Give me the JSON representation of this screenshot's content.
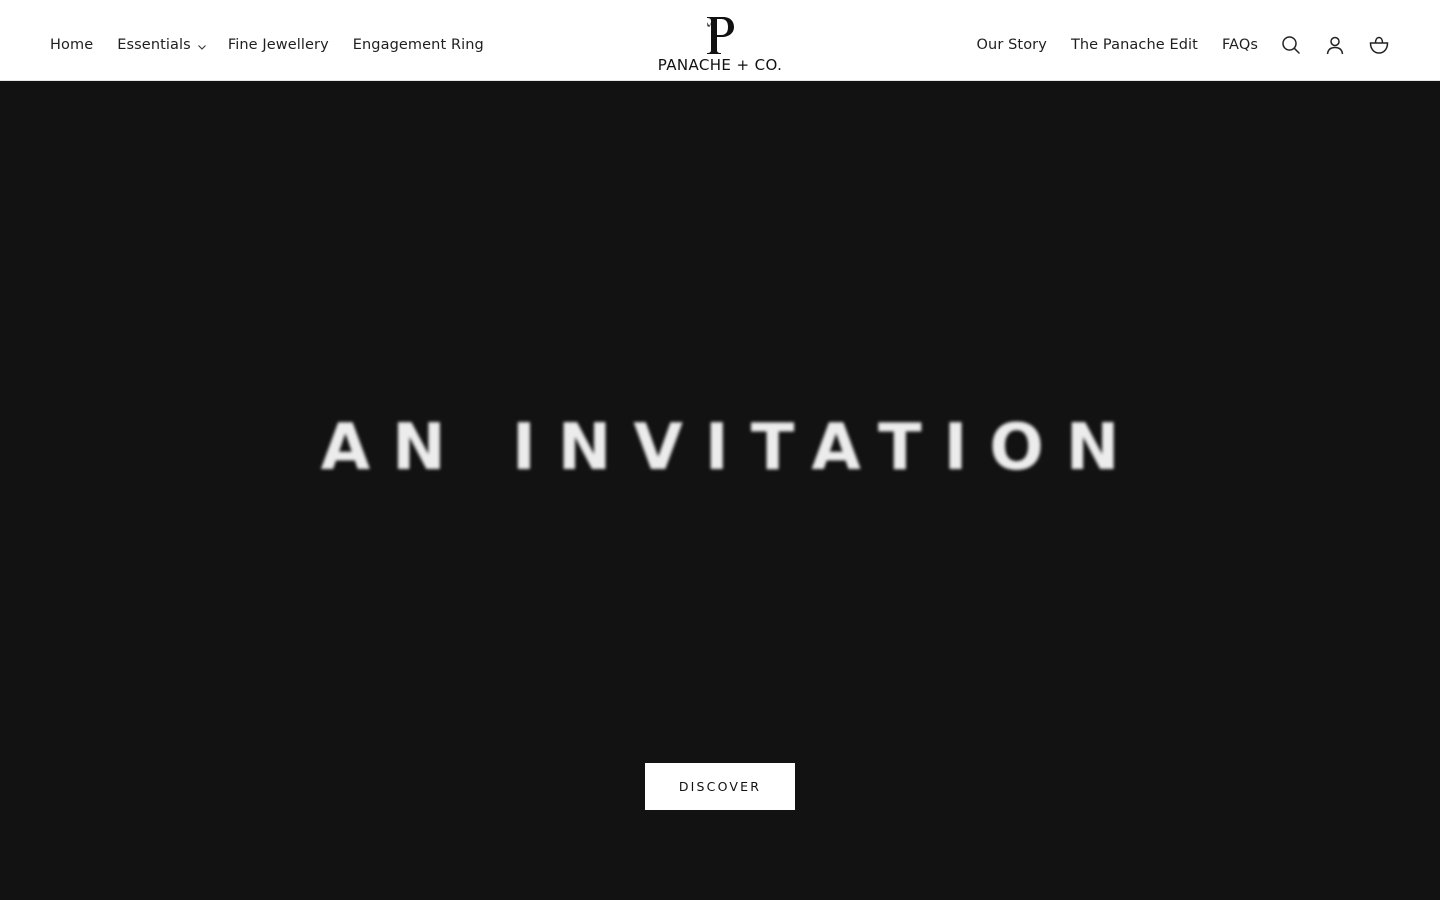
{
  "brand": {
    "name": "PANACHE + CO.",
    "logo_icon": "p-monogram-logo"
  },
  "nav_left": [
    {
      "label": "Home"
    },
    {
      "label": "Essentials",
      "has_dropdown": true
    },
    {
      "label": "Fine Jewellery"
    },
    {
      "label": "Engagement Ring"
    }
  ],
  "nav_right": [
    {
      "label": "Our Story"
    },
    {
      "label": "The Panache Edit"
    },
    {
      "label": "FAQs"
    }
  ],
  "header_icons": [
    "search-icon",
    "account-icon",
    "cart-icon"
  ],
  "hero": {
    "title": "AN INVITATION",
    "cta_label": "DISCOVER",
    "background_color": "#121212"
  }
}
